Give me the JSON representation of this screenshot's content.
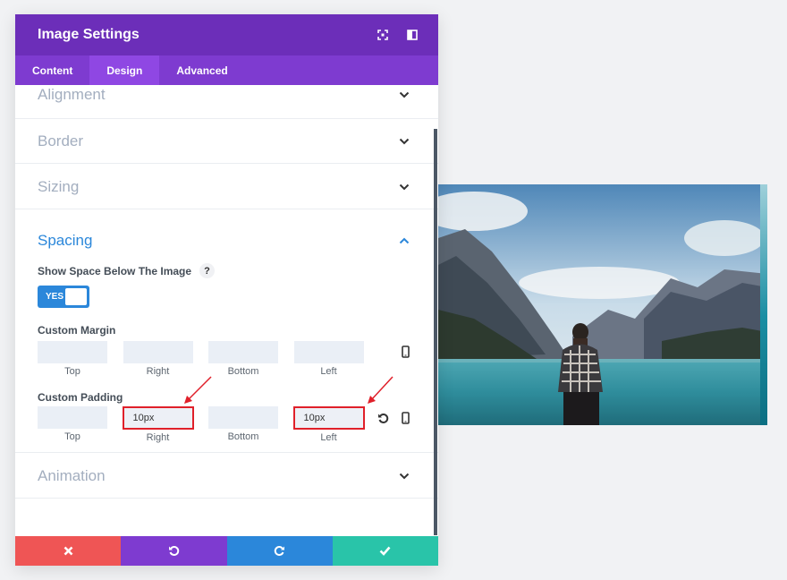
{
  "modal": {
    "title": "Image Settings",
    "header_icons": [
      "fullscreen-icon",
      "split-view-icon"
    ]
  },
  "tabs": [
    {
      "label": "Content",
      "active": false
    },
    {
      "label": "Design",
      "active": true
    },
    {
      "label": "Advanced",
      "active": false
    }
  ],
  "sections": {
    "alignment": {
      "title": "Alignment",
      "expanded": false
    },
    "border": {
      "title": "Border",
      "expanded": false
    },
    "sizing": {
      "title": "Sizing",
      "expanded": false
    },
    "spacing": {
      "title": "Spacing",
      "expanded": true,
      "show_space": {
        "label": "Show Space Below The Image",
        "help": "?",
        "toggle_label": "YES",
        "value": true
      },
      "margin": {
        "label": "Custom Margin",
        "fields": [
          {
            "caption": "Top",
            "value": ""
          },
          {
            "caption": "Right",
            "value": ""
          },
          {
            "caption": "Bottom",
            "value": ""
          },
          {
            "caption": "Left",
            "value": ""
          }
        ]
      },
      "padding": {
        "label": "Custom Padding",
        "fields": [
          {
            "caption": "Top",
            "value": ""
          },
          {
            "caption": "Right",
            "value": "10px"
          },
          {
            "caption": "Bottom",
            "value": ""
          },
          {
            "caption": "Left",
            "value": "10px"
          }
        ]
      }
    },
    "animation": {
      "title": "Animation",
      "expanded": false
    }
  },
  "footer": {
    "buttons": [
      {
        "name": "discard",
        "icon": "close-icon",
        "color": "#ef5555"
      },
      {
        "name": "undo",
        "icon": "undo-icon",
        "color": "#7e3bd0"
      },
      {
        "name": "redo",
        "icon": "redo-icon",
        "color": "#2b87da"
      },
      {
        "name": "save",
        "icon": "check-icon",
        "color": "#29c4a9"
      }
    ]
  },
  "colors": {
    "header": "#6c2eb9",
    "tabs": "#7e3bd0",
    "active_tab": "#8f47e3",
    "accent": "#2b87da",
    "highlight_box": "#e0202a"
  }
}
